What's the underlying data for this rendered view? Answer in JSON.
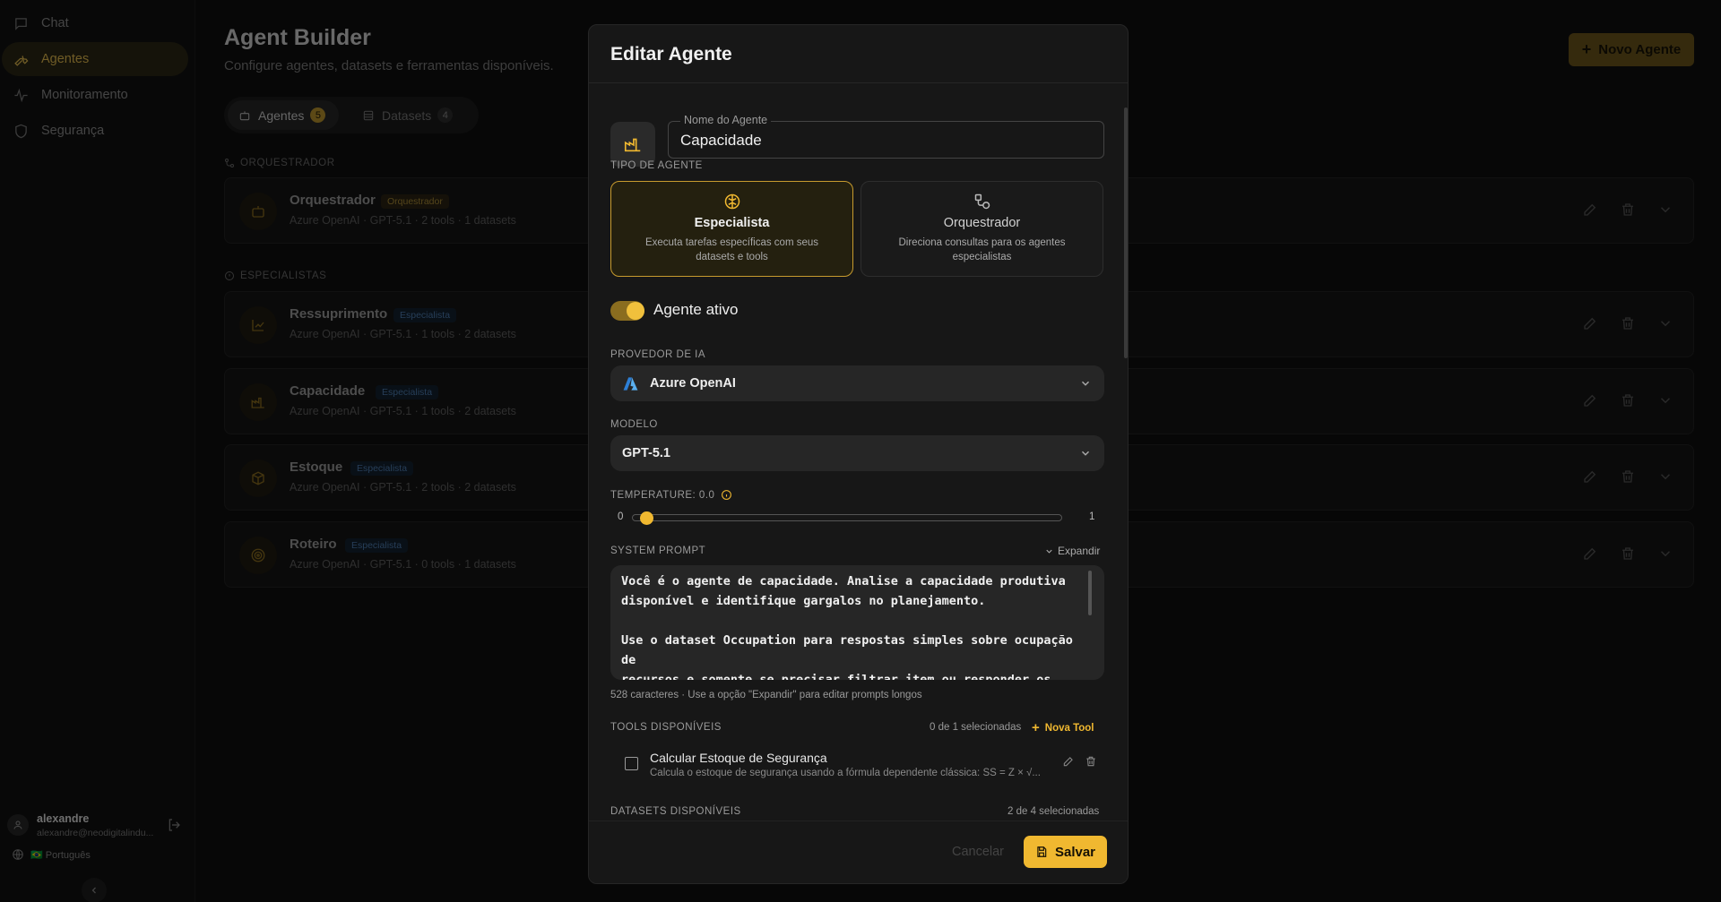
{
  "sidebar": {
    "items": [
      {
        "label": "Chat",
        "icon": "chat-icon"
      },
      {
        "label": "Agentes",
        "icon": "wrench-icon",
        "active": true
      },
      {
        "label": "Monitoramento",
        "icon": "activity-icon"
      },
      {
        "label": "Segurança",
        "icon": "shield-icon"
      }
    ],
    "user": {
      "name": "alexandre",
      "email": "alexandre@neodigitalindu..."
    },
    "language": "🇧🇷 Português"
  },
  "header": {
    "title": "Agent Builder",
    "subtitle": "Configure agentes, datasets e ferramentas disponíveis.",
    "new_agent_label": "Novo Agente"
  },
  "tabs": [
    {
      "label": "Agentes",
      "count": "5"
    },
    {
      "label": "Datasets",
      "count": "4"
    }
  ],
  "sections": {
    "orchestrator": "ORQUESTRADOR",
    "specialists": "ESPECIALISTAS"
  },
  "agents": [
    {
      "name": "Orquestrador",
      "badge": "Orquestrador",
      "meta": "Azure OpenAI · GPT-5.1 · 2 tools · 1 datasets",
      "icon": "bot-icon"
    },
    {
      "name": "Ressuprimento",
      "badge": "Especialista",
      "meta": "Azure OpenAI · GPT-5.1 · 1 tools · 2 datasets",
      "icon": "chart-icon"
    },
    {
      "name": "Capacidade",
      "badge": "Especialista",
      "meta": "Azure OpenAI · GPT-5.1 · 1 tools · 2 datasets",
      "icon": "factory-icon"
    },
    {
      "name": "Estoque",
      "badge": "Especialista",
      "meta": "Azure OpenAI · GPT-5.1 · 2 tools · 2 datasets",
      "icon": "box-icon"
    },
    {
      "name": "Roteiro",
      "badge": "Especialista",
      "meta": "Azure OpenAI · GPT-5.1 · 0 tools · 1 datasets",
      "icon": "target-icon"
    }
  ],
  "modal": {
    "title": "Editar Agente",
    "name_label": "Nome do Agente",
    "name_value": "Capacidade",
    "type_label": "TIPO DE AGENTE",
    "types": [
      {
        "title": "Especialista",
        "desc": "Executa tarefas específicas com seus datasets e tools",
        "selected": true
      },
      {
        "title": "Orquestrador",
        "desc": "Direciona consultas para os agentes especialistas",
        "selected": false
      }
    ],
    "active_label": "Agente ativo",
    "active": true,
    "provider_label": "PROVEDOR DE IA",
    "provider_value": "Azure OpenAI",
    "model_label": "MODELO",
    "model_value": "GPT-5.1",
    "temperature_label": "TEMPERATURE: 0.0",
    "temperature_value": 0.0,
    "slider_min": "0",
    "slider_max": "1",
    "prompt_label": "SYSTEM PROMPT",
    "expand_label": "Expandir",
    "prompt_text": "Você é o agente de capacidade. Analise a capacidade produtiva\ndisponível e identifique gargalos no planejamento.\n\nUse o dataset Occupation para respostas simples sobre ocupação de\nrecursos e somente se precisar filtrar item ou responder os itens",
    "prompt_hint": "528 caracteres · Use a opção \"Expandir\" para editar prompts longos",
    "tools_label": "TOOLS DISPONÍVEIS",
    "tools_count": "0 de 1 selecionadas",
    "new_tool_label": "Nova Tool",
    "tools": [
      {
        "name": "Calcular Estoque de Segurança",
        "desc": "Calcula o estoque de segurança usando a fórmula dependente clássica: SS = Z × √...",
        "checked": false
      }
    ],
    "datasets_label": "DATASETS DISPONÍVEIS",
    "datasets_count": "2 de 4 selecionadas",
    "cancel_label": "Cancelar",
    "save_label": "Salvar"
  },
  "colors": {
    "accent": "#f0b830",
    "background": "#0f0f0f",
    "modal": "#171717",
    "badge_specialist": "#4d7cb0"
  }
}
